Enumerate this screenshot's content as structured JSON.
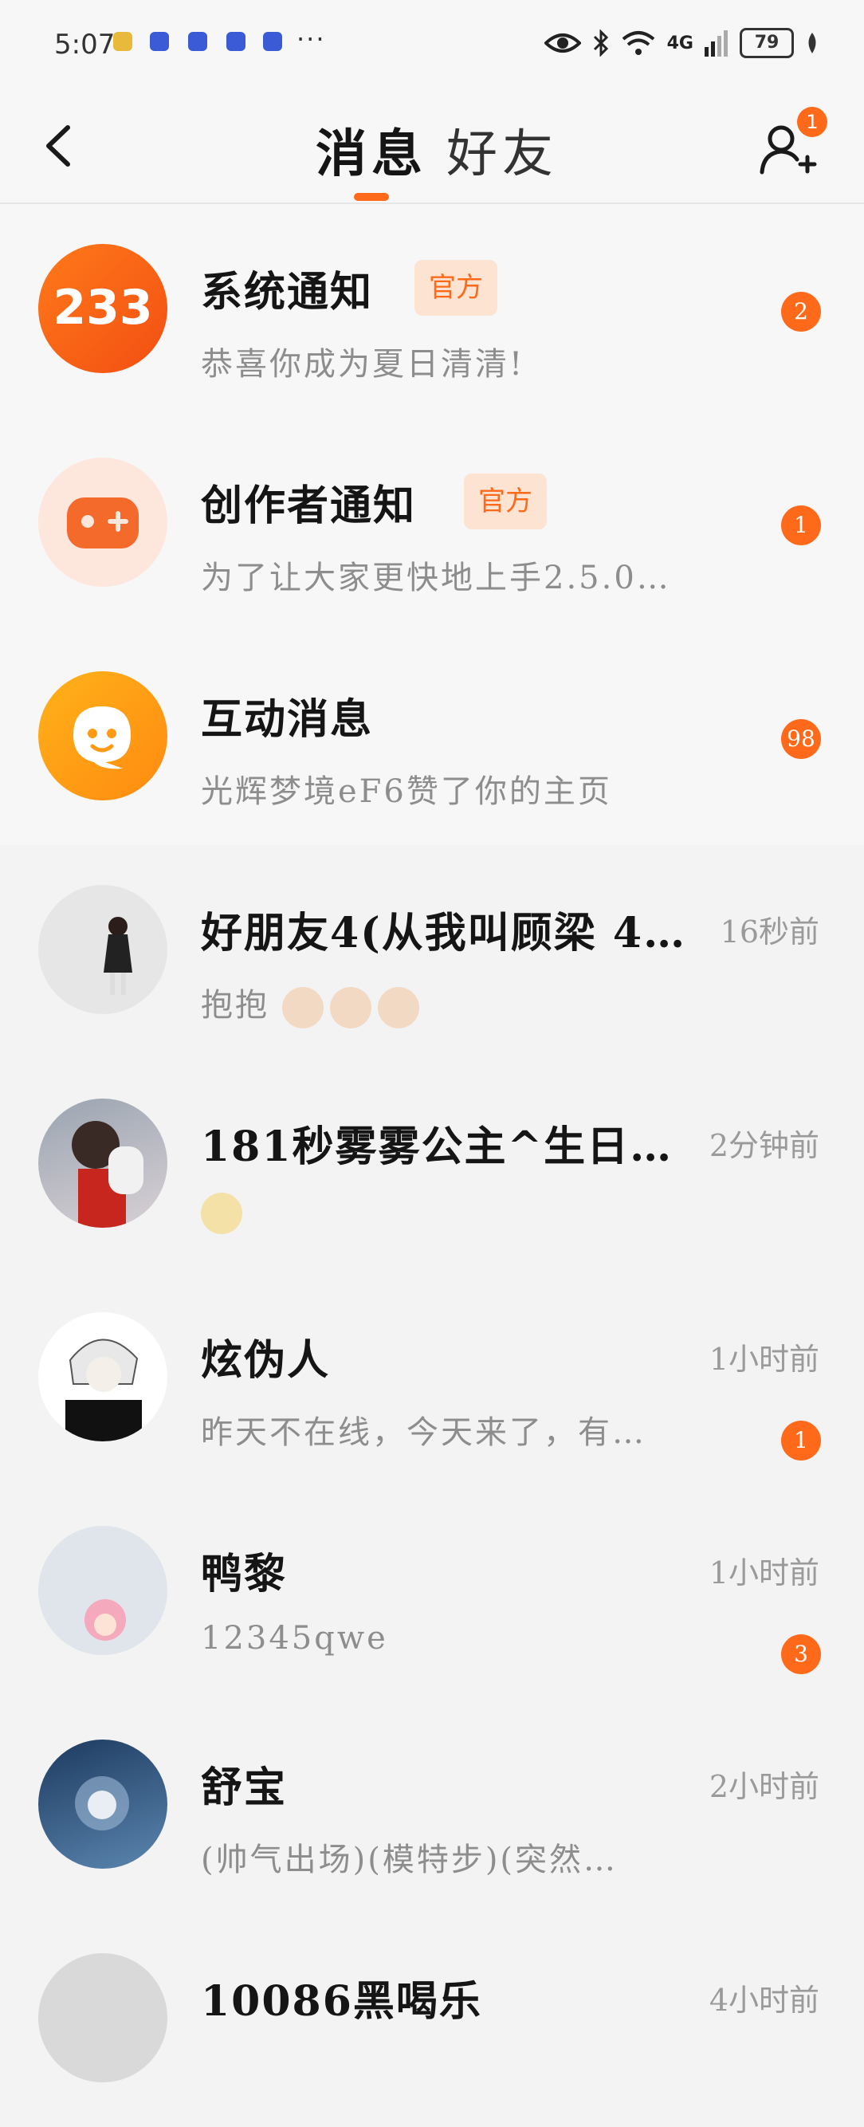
{
  "status_bar": {
    "time": "5:07",
    "more": "···",
    "network": "4G",
    "battery": "79"
  },
  "header": {
    "tabs": [
      {
        "label": "消息",
        "active": true
      },
      {
        "label": "好友",
        "active": false
      }
    ],
    "add_friend_badge": "1",
    "icons": {
      "back": "chevron-left-icon",
      "add_friend": "add-user-icon"
    }
  },
  "colors": {
    "accent": "#ff6a1a",
    "tag_bg": "#fde3d2",
    "muted_text": "#8d8d8d"
  },
  "official_items": [
    {
      "title": "系统通知",
      "tag": "官方",
      "preview": "恭喜你成为夏日清清!",
      "badge": "2",
      "avatar_icon": "233-logo-icon"
    },
    {
      "title": "创作者通知",
      "tag": "官方",
      "preview": "为了让大家更快地上手2.5.0…",
      "badge": "1",
      "avatar_icon": "gamepad-icon"
    },
    {
      "title": "互动消息",
      "tag": "",
      "preview": "光辉梦境eF6赞了你的主页",
      "badge": "98",
      "avatar_icon": "chat-bubble-icon"
    }
  ],
  "chats": [
    {
      "name": "好朋友4(从我叫顾梁 4f…",
      "preview": "抱抱",
      "time": "16秒前",
      "badge": "",
      "emoji_count": 3
    },
    {
      "name": "181秒雾雾公主^生日11…",
      "preview": "",
      "time": "2分钟前",
      "badge": "",
      "emoji_count": 1
    },
    {
      "name": "炫伪人",
      "preview": "昨天不在线，今天来了，有…",
      "time": "1小时前",
      "badge": "1",
      "emoji_count": 0
    },
    {
      "name": "鸭黎",
      "preview": "12345qwe",
      "time": "1小时前",
      "badge": "3",
      "emoji_count": 0
    },
    {
      "name": "舒宝",
      "preview": "(帅气出场)(模特步)(突然…",
      "time": "2小时前",
      "badge": "",
      "emoji_count": 0
    },
    {
      "name": "10086黑喝乐",
      "preview": "",
      "time": "4小时前",
      "badge": "",
      "emoji_count": 0
    }
  ]
}
